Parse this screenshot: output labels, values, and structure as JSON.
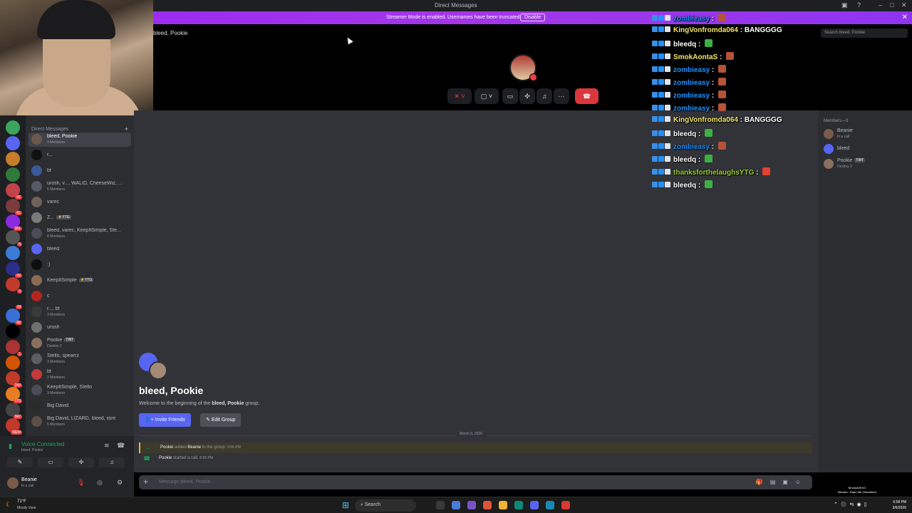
{
  "window": {
    "title": "Direct Messages"
  },
  "banner": {
    "text": "Streamer Mode is enabled. Usernames have been truncated.",
    "button": "Disable"
  },
  "call": {
    "channel_title": "bleed, Pookie",
    "buttons": [
      "mute-toggle",
      "camera-toggle",
      "screen-share",
      "activities",
      "soundboard",
      "more",
      "leave-call"
    ]
  },
  "dm_sidebar": {
    "header": "Direct Messages",
    "items": [
      {
        "name": "bleed, Pookie",
        "sub": "3 Members",
        "selected": true,
        "color": "#6b5a4c"
      },
      {
        "name": "r...",
        "sub": "",
        "color": "#111111"
      },
      {
        "name": "bt",
        "sub": "",
        "color": "#3b5998"
      },
      {
        "name": "urosh, v..., WALID, CheeseWiz, ...",
        "sub": "6 Members",
        "color": "#555a66"
      },
      {
        "name": "varec",
        "sub": "",
        "color": "#6e6259"
      },
      {
        "name": "Z...",
        "tag": "⚡YTG",
        "sub": "",
        "color": "#7a7a7a"
      },
      {
        "name": "bleed, varec, KeepItSimple, Ste...",
        "sub": "8 Members",
        "color": "#4a4d55"
      },
      {
        "name": "bleed",
        "sub": "",
        "color": "#5865f2"
      },
      {
        "name": ":)",
        "sub": "",
        "color": "#0d0d0d"
      },
      {
        "name": "KeepItSimple",
        "tag": "⚡YTG",
        "sub": "",
        "color": "#8a6b52"
      },
      {
        "name": "c",
        "sub": "",
        "color": "#b3261e"
      },
      {
        "name": "r..., bt",
        "sub": "3 Members",
        "color": "#3a3a3a"
      },
      {
        "name": "urosh",
        "sub": "",
        "color": "#6f6f6f"
      },
      {
        "name": "Pookie",
        "tag": "TWT",
        "sub": "Destiny 2",
        "color": "#8a6e5e"
      },
      {
        "name": "Stello, spearrz",
        "sub": "3 Members",
        "color": "#5a5d63"
      },
      {
        "name": "bt",
        "sub": "2 Members",
        "color": "#c23b3b"
      },
      {
        "name": "KeepItSimple, Stello",
        "sub": "3 Members",
        "color": "#4a4d55"
      },
      {
        "name": "Big David",
        "sub": "",
        "color": "#2a2a2a"
      },
      {
        "name": "Big David, LIZARD, bleed, iisnt",
        "sub": "5 Members",
        "color": "#5c4f45"
      }
    ]
  },
  "server_rail": {
    "badges": [
      "",
      "",
      "",
      "",
      "47",
      "61",
      "161",
      "5",
      "",
      "42",
      "3",
      "Sf",
      "42",
      "",
      "1",
      "",
      "243",
      "170",
      "347",
      "NEW"
    ]
  },
  "voice_panel": {
    "status": "Voice Connected",
    "channel": "bleed, Pookie"
  },
  "user_panel": {
    "name": "Beanie",
    "status": "In a call"
  },
  "members": {
    "header": "Members—3",
    "list": [
      {
        "name": "Beanie",
        "status": "In a call",
        "color": "#7a5a49"
      },
      {
        "name": "bleed",
        "status": "",
        "color": "#5865f2"
      },
      {
        "name": "Pookie",
        "tag": "TWT",
        "status": "Destiny 2",
        "color": "#8a6e5e"
      }
    ]
  },
  "search": {
    "placeholder": "Search bleed, Pookie"
  },
  "welcome": {
    "title": "bleed, Pookie",
    "desc_prefix": "Welcome to the beginning of the ",
    "desc_group": "bleed, Pookie",
    "desc_suffix": " group.",
    "invite": "Invite Friends",
    "edit": "Edit Group"
  },
  "date_divider": "March 6, 2026",
  "system_messages": [
    {
      "actor": "Pookie",
      "verb": " added ",
      "target": "Beanie",
      "rest": " to the group.",
      "time": "6:56 PM"
    },
    {
      "actor": "Pookie",
      "verb": " started a call.",
      "target": "",
      "rest": "",
      "time": "6:56 PM"
    }
  ],
  "composer": {
    "placeholder": "Message bleed, Pookie"
  },
  "overlay_chat": [
    {
      "user": "zombieasy",
      "color": "#1e90ff",
      "text": "",
      "emote": "#b5523a"
    },
    {
      "user": "KingVonfromda064",
      "color": "#f5e663",
      "text": "BANGGGG",
      "emote": ""
    },
    {
      "user": "bleedq",
      "color": "#ffffff",
      "text": "",
      "emote": "#3cb043"
    },
    {
      "user": "SmokAontaS",
      "color": "#f5e663",
      "text": "",
      "emote": "#b5523a"
    },
    {
      "user": "zombieasy",
      "color": "#1e90ff",
      "text": "",
      "emote": "#b5523a"
    },
    {
      "user": "zombieasy",
      "color": "#1e90ff",
      "text": "",
      "emote": "#b5523a"
    },
    {
      "user": "zombieasy",
      "color": "#1e90ff",
      "text": "",
      "emote": "#b5523a"
    },
    {
      "user": "zombieasy",
      "color": "#1e90ff",
      "text": "",
      "emote": "#b5523a"
    },
    {
      "user": "KingVonfromda064",
      "color": "#f5e663",
      "text": "BANGGGG",
      "emote": ""
    },
    {
      "user": "bleedq",
      "color": "#ffffff",
      "text": "",
      "emote": "#3cb043"
    },
    {
      "user": "zombieasy",
      "color": "#1e90ff",
      "text": "",
      "emote": "#b5523a"
    },
    {
      "user": "bleedq",
      "color": "#ffffff",
      "text": "",
      "emote": "#3cb043"
    },
    {
      "user": "thanksforthelaughsYTG",
      "color": "#9acd32",
      "text": "",
      "emote": "#e3412f"
    },
    {
      "user": "bleedq",
      "color": "#ffffff",
      "text": "",
      "emote": "#3cb043"
    }
  ],
  "taskbar": {
    "weather_temp": "71°F",
    "weather_desc": "Mostly clear",
    "search": "Search",
    "now_playing_artist": "NirvanaVEVO",
    "now_playing_track": "Nirvana - Rape Me (Visualizer)",
    "time": "6:58 PM",
    "date": "3/6/2026"
  },
  "colors": {
    "accent": "#5865f2",
    "banner": "#a436e8",
    "leave": "#da373c",
    "online": "#23a55a"
  }
}
